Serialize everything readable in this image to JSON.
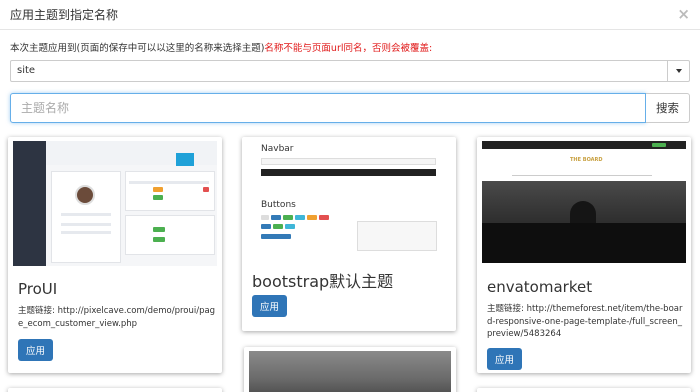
{
  "modal": {
    "title": "应用主题到指定名称",
    "close": "×"
  },
  "notice": {
    "normal": "本次主题应用到(页面的保存中可以以这里的名称来选择主题)",
    "warning": "名称不能与页面url同名，否则会被覆盖:"
  },
  "select": {
    "value": "site"
  },
  "search": {
    "placeholder": "主题名称",
    "button": "搜索"
  },
  "themes": [
    {
      "name": "ProUI",
      "link_label": "主题链接:",
      "link": "http://pixelcave.com/demo/proui/page_ecom_customer_view.php",
      "apply": "应用"
    },
    {
      "name": "bootstrap默认主题",
      "apply": "应用",
      "thumb": {
        "section1": "Navbar",
        "section2": "Buttons"
      }
    },
    {
      "name": "envatomarket",
      "link_label": "主题链接:",
      "link": "http://themeforest.net/item/the-board-responsive-one-page-template-/full_screen_preview/5483264",
      "apply": "应用",
      "thumb": {
        "heading": "THE BOARD"
      }
    }
  ],
  "colors": {
    "primary": "#2f75b7",
    "warning": "#e01818",
    "focus": "#66afe9"
  }
}
